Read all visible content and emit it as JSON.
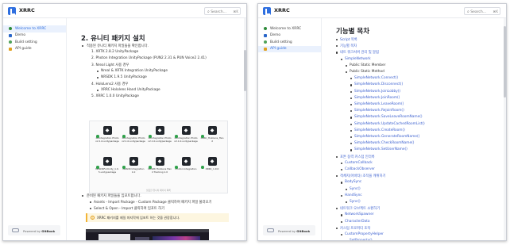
{
  "app": {
    "title": "XRRC",
    "search_placeholder": "Search...",
    "search_kbd": "⌘K",
    "powered_prefix": "Powered by",
    "powered_brand": "GitBook"
  },
  "sidebar": {
    "items": [
      {
        "label": "Welcome to XRRC",
        "icon": "home-icon"
      },
      {
        "label": "Demo",
        "icon": "demo-icon"
      },
      {
        "label": "Build setting",
        "icon": "gear-icon"
      },
      {
        "label": "API guide",
        "icon": "api-icon"
      }
    ],
    "active_left": 0,
    "active_right": 3
  },
  "left_page": {
    "heading": "2. 유니티 패키지 설치",
    "intro": "적용된 유니티 패키지 파일들을 확인합니다.",
    "steps": [
      "1.  XRTK 2.8.2 UnityPackage",
      "2.  Photon Integration UnityPackage (PUN2 2.31 & PUN Voice2 2.41)",
      "3.  Nreal Light 사용 경우",
      "4.  HoloLens2 사용 경우",
      "5.  XRRC 1.0.0 UnityPackage"
    ],
    "nreal_sub": [
      "Nreal & XRTK Integration UnityPackage",
      "NRSDK 1.9.5 UnityPackage"
    ],
    "holo_sub": [
      "XRRC Hololens Hand UnityPackage"
    ],
    "packages": [
      "XRIntegration Photon2.1.0.unitypackage",
      "XRIntegration Photon2.1.0.unitypackage",
      "XRIntegration Photon2.1.0.unitypackage",
      "XRIntegration Photon2.1.0.unitypackage",
      "NRSDKForUnity_1.9.5.unitypackage",
      "NRSDK Integration 1.0",
      "XRSDK Hololens Hand Tracking 1.0",
      "Photon Integration",
      "XRRC_1.0.0",
      "XRRC_Hololens_Hand"
    ],
    "grid_caption": "필요한 유니티 패키지 목록",
    "install_intro": "준비된 패키지 파일들을 임포트합니다.",
    "install_sub": [
      "Assets - Import Package - Custom Package 클릭하여 패키지 파일 불러오기",
      "Select & Open - Import 클릭하여 임포트 하기"
    ],
    "info": "XRRC 패키지를 제일 마지막에 임포트 하는 것을 권장합니다."
  },
  "right_page": {
    "heading": "기능별 목차",
    "toc": [
      {
        "level": 0,
        "text": "Script 목록"
      },
      {
        "level": 0,
        "text": "기능별 목차"
      },
      {
        "level": 0,
        "text": "네트 워크서버 관리 및 알림"
      },
      {
        "level": 1,
        "text": "SimpleNetwork"
      },
      {
        "level": 2,
        "text": "Public Static Member",
        "plain": true
      },
      {
        "level": 2,
        "text": "Public Static Method",
        "plain": true
      },
      {
        "level": 3,
        "text": "SimpleNetwork.Connect()"
      },
      {
        "level": 3,
        "text": "SimpleNetwork.Disconnect()"
      },
      {
        "level": 3,
        "text": "SimpleNetwork.JoinLobby()"
      },
      {
        "level": 3,
        "text": "SimpleNetwork.JoinRoom()"
      },
      {
        "level": 3,
        "text": "SimpleNetwork.LeaveRoom()"
      },
      {
        "level": 3,
        "text": "SimpleNetwork.RejoinRoom()"
      },
      {
        "level": 3,
        "text": "SimpleNetwork.SaveLeaveRoomName()"
      },
      {
        "level": 3,
        "text": "SimpleNetwork.UpdateCachedRoomList()"
      },
      {
        "level": 3,
        "text": "SimpleNetwork.CreateRoom()"
      },
      {
        "level": 3,
        "text": "SimpleNetwork.GenerateRoomName()"
      },
      {
        "level": 3,
        "text": "SimpleNetwork.CheckRoomName()"
      },
      {
        "level": 3,
        "text": "SimpleNetwork.SetUserName()"
      },
      {
        "level": 0,
        "text": "포톤 동력 커스텀 인터록"
      },
      {
        "level": 1,
        "text": "CustomCallback"
      },
      {
        "level": 1,
        "text": "CallbackObserver"
      },
      {
        "level": 0,
        "text": "객체지(아바타) 조작을 캐위하기"
      },
      {
        "level": 1,
        "text": "BodySync"
      },
      {
        "level": 2,
        "text": "Sync()"
      },
      {
        "level": 1,
        "text": "HandSync"
      },
      {
        "level": 2,
        "text": "Sync()"
      },
      {
        "level": 0,
        "text": "네트워크 오브젝트 소환하기"
      },
      {
        "level": 1,
        "text": "NetworkSpawner"
      },
      {
        "level": 1,
        "text": "CharacterData"
      },
      {
        "level": 0,
        "text": "커스텀 프로퍼티 조작"
      },
      {
        "level": 1,
        "text": "CustomPropertyHelper"
      },
      {
        "level": 2,
        "text": "SetProperty()"
      }
    ]
  }
}
